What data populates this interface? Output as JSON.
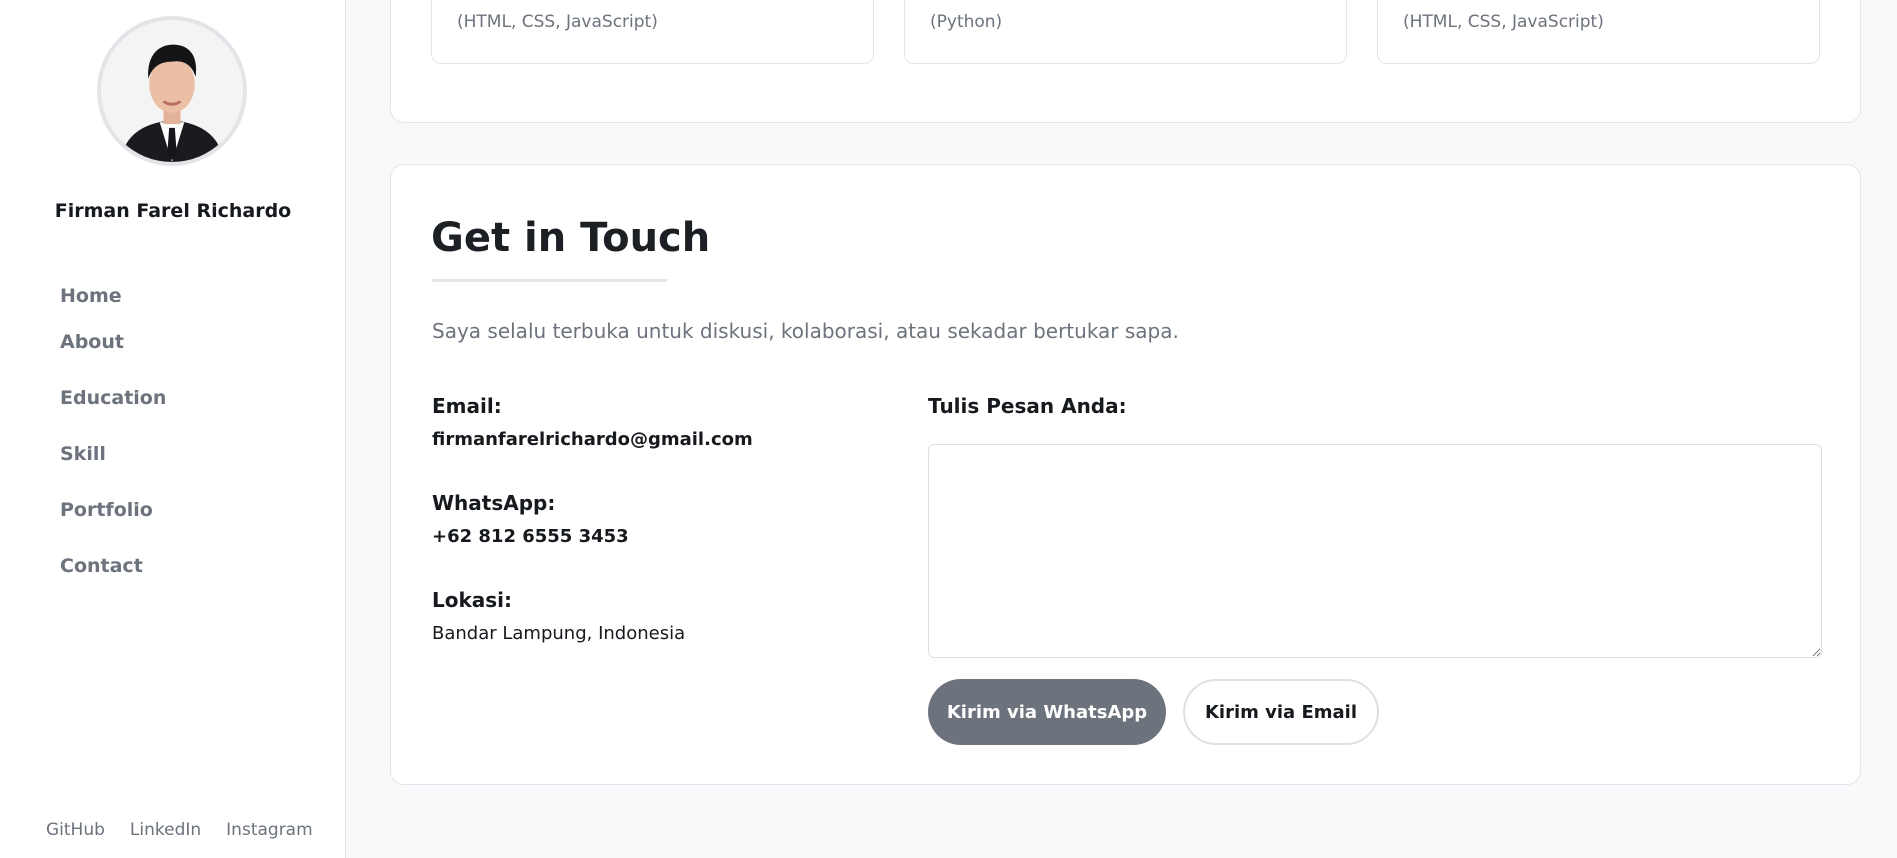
{
  "sidebar": {
    "name": "Firman Farel Richardo",
    "nav": [
      "Home",
      "About",
      "Education",
      "Skill",
      "Portfolio",
      "Contact"
    ],
    "social": [
      "GitHub",
      "LinkedIn",
      "Instagram"
    ]
  },
  "portfolio": {
    "projects": [
      {
        "tech": "(HTML, CSS, JavaScript)"
      },
      {
        "tech": "(Python)"
      },
      {
        "tech": "(HTML, CSS, JavaScript)"
      }
    ]
  },
  "contact": {
    "title": "Get in Touch",
    "subtitle": "Saya selalu terbuka untuk diskusi, kolaborasi, atau sekadar bertukar sapa.",
    "email_label": "Email:",
    "email": "firmanfarelrichardo@gmail.com",
    "whatsapp_label": "WhatsApp:",
    "whatsapp": "+62 812 6555 3453",
    "location_label": "Lokasi:",
    "location": "Bandar Lampung, Indonesia",
    "form_label": "Tulis Pesan Anda:",
    "message_value": "",
    "btn_whatsapp": "Kirim via WhatsApp",
    "btn_email": "Kirim via Email"
  },
  "colors": {
    "accent_button": "#6c737c",
    "muted_text": "#6c737c",
    "border": "#e3e5e8"
  }
}
